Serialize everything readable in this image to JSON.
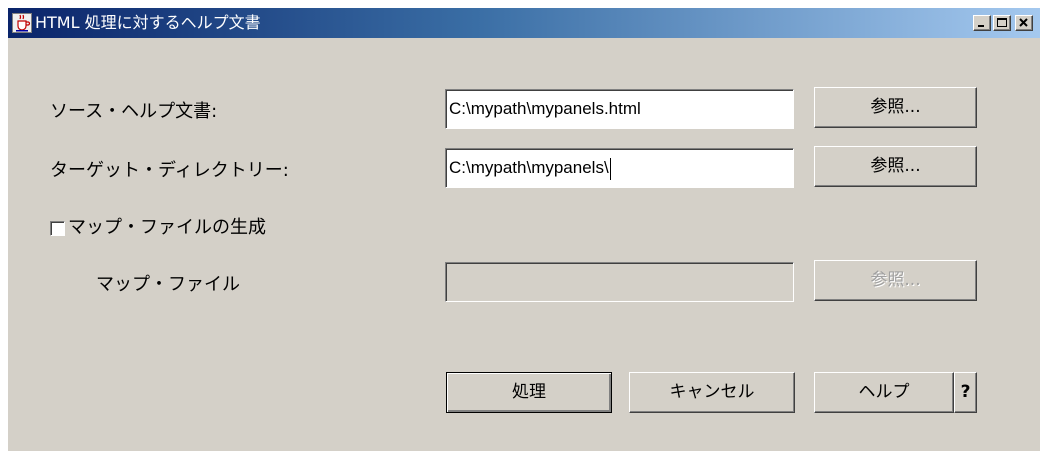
{
  "window": {
    "title": "HTML 処理に対するヘルプ文書",
    "controls": {
      "minimize_icon": "minimize-icon",
      "maximize_icon": "maximize-icon",
      "close_icon": "close-icon"
    }
  },
  "form": {
    "source_label": "ソース・ヘルプ文書:",
    "source_value": "C:\\mypath\\mypanels.html",
    "target_label": "ターゲット・ディレクトリー:",
    "target_value": "C:\\mypath\\mypanels\\",
    "generate_map_label": "マップ・ファイルの生成",
    "generate_map_checked": false,
    "map_file_label": "マップ・ファイル",
    "map_file_value": "",
    "browse_label": "参照..."
  },
  "buttons": {
    "process": "処理",
    "cancel": "キャンセル",
    "help": "ヘルプ",
    "question": "?"
  },
  "colors": {
    "title_start": "#0a246a",
    "title_end": "#a6caf0",
    "face": "#d4d0c8",
    "disabled_text": "#a0a0a0"
  }
}
